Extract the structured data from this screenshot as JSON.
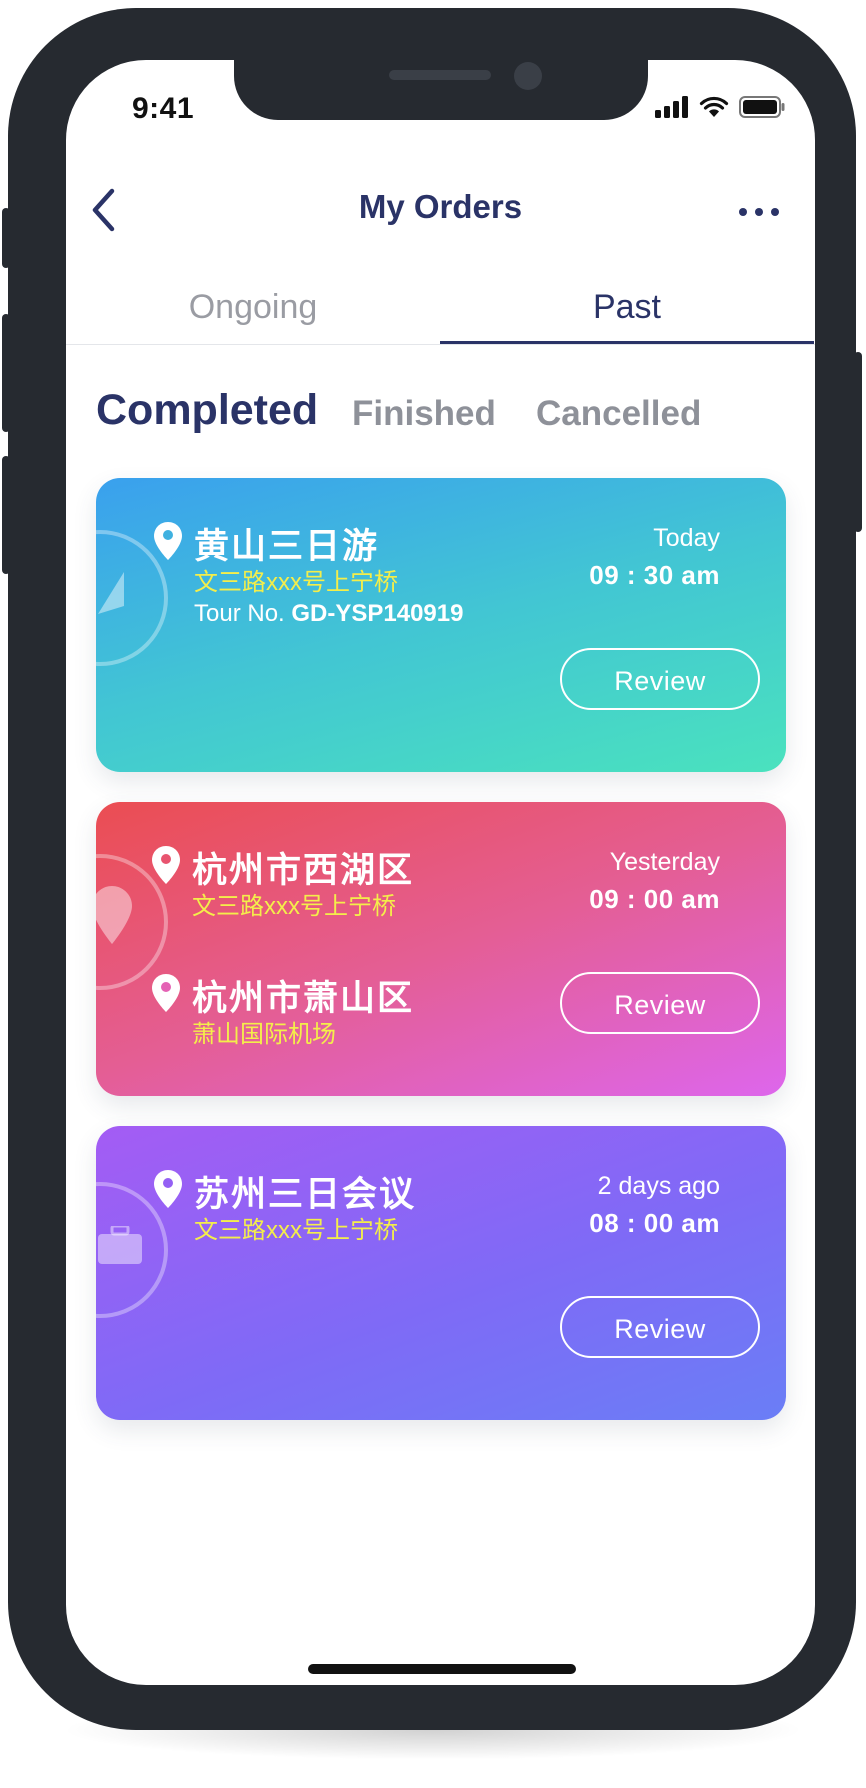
{
  "status_bar": {
    "time": "9:41"
  },
  "nav": {
    "title": "My Orders"
  },
  "tabs": [
    {
      "label": "Ongoing",
      "active": false
    },
    {
      "label": "Past",
      "active": true
    }
  ],
  "filters": [
    {
      "label": "Completed",
      "active": true
    },
    {
      "label": "Finished",
      "active": false
    },
    {
      "label": "Cancelled",
      "active": false
    }
  ],
  "orders": [
    {
      "place": "黄山三日游",
      "address": "文三路xxx号上宁桥",
      "tour_prefix": "Tour No.",
      "tour_no": "GD-YSP140919",
      "day": "Today",
      "time": "09 : 30 am",
      "action": "Review",
      "watermark_icon": "compass-icon"
    },
    {
      "place": "杭州市西湖区",
      "address": "文三路xxx号上宁桥",
      "place2": "杭州市萧山区",
      "address2": "萧山国际机场",
      "day": "Yesterday",
      "time": "09 : 00 am",
      "action": "Review",
      "watermark_icon": "map-pin-icon"
    },
    {
      "place": "苏州三日会议",
      "address": "文三路xxx号上宁桥",
      "day": "2 days ago",
      "time": "08 : 00 am",
      "action": "Review",
      "watermark_icon": "briefcase-icon"
    }
  ],
  "colors": {
    "primary_navy": "#2a3367",
    "muted_text": "#8e9199",
    "address_yellow": "#f4ee4a",
    "card1_gradient": [
      "#3aa0ee",
      "#4ae2be"
    ],
    "card2_gradient": [
      "#eb4d52",
      "#dd66ec"
    ],
    "card3_gradient": [
      "#a45cf4",
      "#6a7ef6"
    ]
  }
}
